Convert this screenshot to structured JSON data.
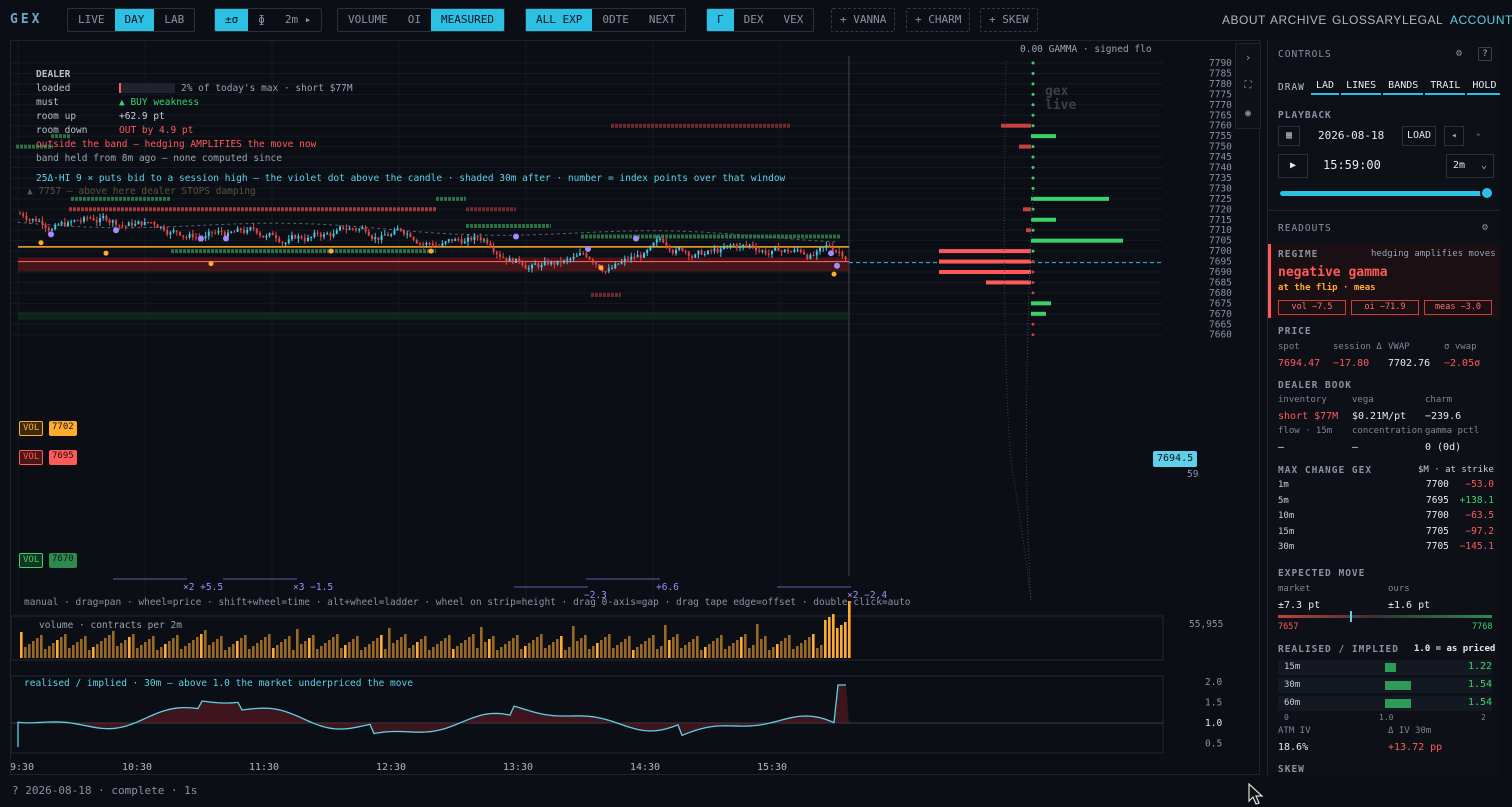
{
  "app": {
    "logo": "GEX"
  },
  "toolbar": {
    "mode": [
      "LIVE",
      "DAY",
      "LAB"
    ],
    "scale": [
      "±σ",
      "ɸ",
      "2m ▸"
    ],
    "basis": [
      "VOLUME",
      "OI",
      "MEASURED"
    ],
    "expiry": [
      "ALL EXP",
      "0DTE",
      "NEXT"
    ],
    "greek": [
      "Γ",
      "DEX",
      "VEX"
    ],
    "addons": [
      "+ VANNA",
      "+ CHARM",
      "+ SKEW"
    ],
    "nav": [
      "ABOUT",
      "ARCHIVE",
      "GLOSSARY",
      "LEGAL",
      "ACCOUNT"
    ]
  },
  "chart": {
    "header": "0.00   GAMMA · signed flo",
    "watermark": "gex live",
    "dealer": {
      "title": "DEALER",
      "rows": [
        {
          "k": "loaded",
          "v": "2% of today's max · short $77M"
        },
        {
          "k": "must",
          "v": "▲ BUY weakness"
        },
        {
          "k": "room up",
          "v": "+62.9 pt"
        },
        {
          "k": "room down",
          "v": "OUT by 4.9 pt"
        }
      ],
      "warn": "outside the band — hedging AMPLIFIES the move now",
      "band": "band held from 8m ago — none computed since",
      "hi": "25Δ·HI 9 × puts bid to a session high — the violet dot above the candle · shaded 30m after · number = index points over that window",
      "stop": "▲ 7757 — above here dealer STOPS damping"
    },
    "yticks": [
      "7790",
      "7785",
      "7780",
      "7775",
      "7770",
      "7765",
      "7760",
      "7755",
      "7750",
      "7745",
      "7740",
      "7735",
      "7730",
      "7725",
      "7720",
      "7715",
      "7710",
      "7705",
      "7700",
      "7695",
      "7690",
      "7685",
      "7680",
      "7675",
      "7670",
      "7665",
      "7660"
    ],
    "spot_label": "7694.5",
    "spot_sub": "59",
    "levels": [
      {
        "tag": "VOL",
        "val": "7702"
      },
      {
        "tag": "VOL",
        "val": "7695"
      },
      {
        "tag": "VOL",
        "val": "7670"
      }
    ],
    "markers": [
      "×2 +5.5",
      "×3 −1.5",
      "−2.3",
      "+6.6",
      "×2 −2.4"
    ],
    "help": "manual · drag=pan · wheel=price · shift+wheel=time · alt+wheel=ladder · wheel on strip=height · drag 0-axis=gap · drag tape edge=offset · double-click=auto",
    "volume": {
      "label": "volume · contracts per 2m",
      "max": "55,955"
    },
    "ri": {
      "label": "realised / implied · 30m  —  above 1.0 the market underpriced the move",
      "ticks": [
        "2.0",
        "1.5",
        "1.0",
        "0.5"
      ]
    },
    "xticks": [
      "9:30",
      "10:30",
      "11:30",
      "12:30",
      "13:30",
      "14:30",
      "15:30"
    ]
  },
  "controls": {
    "title": "CONTROLS",
    "draw_label": "DRAW",
    "draw": [
      "LAD",
      "LINES",
      "BANDS",
      "TRAIL",
      "HOLD"
    ],
    "playback": "PLAYBACK",
    "date": "2026-08-18",
    "load": "LOAD",
    "time": "15:59:00",
    "step": "2m",
    "slider_pct": 100
  },
  "readouts": {
    "title": "READOUTS",
    "regime": {
      "label": "REGIME",
      "note": "hedging amplifies moves",
      "name": "negative gamma",
      "sub": "at the flip · meas",
      "chips": [
        "vol −7.5",
        "oi −71.9",
        "meas −3.0"
      ]
    },
    "price": {
      "label": "PRICE",
      "cols": [
        "spot",
        "session Δ",
        "VWAP",
        "σ vwap"
      ],
      "vals": [
        "7694.47",
        "−17.80",
        "7702.76",
        "−2.05σ"
      ]
    },
    "dealer": {
      "label": "DEALER BOOK",
      "cols": [
        "inventory",
        "vega",
        "charm"
      ],
      "vals": [
        "short $77M",
        "$0.21M/pt",
        "−239.6"
      ],
      "cols2": [
        "flow · 15m",
        "concentration",
        "gamma pctl"
      ],
      "vals2": [
        "—",
        "—",
        "0 (0d)"
      ]
    },
    "maxchange": {
      "label": "MAX CHANGE GEX",
      "unit": "$M · at strike",
      "rows": [
        [
          "1m",
          "7700",
          "−53.0"
        ],
        [
          "5m",
          "7695",
          "+138.1"
        ],
        [
          "10m",
          "7700",
          "−63.5"
        ],
        [
          "15m",
          "7705",
          "−97.2"
        ],
        [
          "30m",
          "7705",
          "−145.1"
        ]
      ]
    },
    "expected": {
      "label": "EXPECTED MOVE",
      "cols": [
        "market",
        "ours"
      ],
      "vals": [
        "±7.3 pt",
        "±1.6 pt"
      ],
      "lo": "7657",
      "hi": "7768"
    },
    "ri": {
      "label": "REALISED / IMPLIED",
      "note": "1.0 = as priced",
      "rows": [
        [
          "15m",
          "1.22",
          1.22
        ],
        [
          "30m",
          "1.54",
          1.54
        ],
        [
          "60m",
          "1.54",
          1.54
        ]
      ],
      "ticks": [
        "0",
        "1.0",
        "2"
      ]
    },
    "iv": {
      "cols": [
        "ATM IV",
        "Δ IV 30m"
      ],
      "vals": [
        "18.6%",
        "+13.72 pp"
      ]
    },
    "skew": "SKEW"
  },
  "footer": "?  2026-08-18 · complete · 1s",
  "colors": {
    "accent": "#2bc0e4",
    "red": "#ff5a5a",
    "green": "#3ad36a",
    "orange": "#ffab2e",
    "violet": "#a28bff"
  }
}
